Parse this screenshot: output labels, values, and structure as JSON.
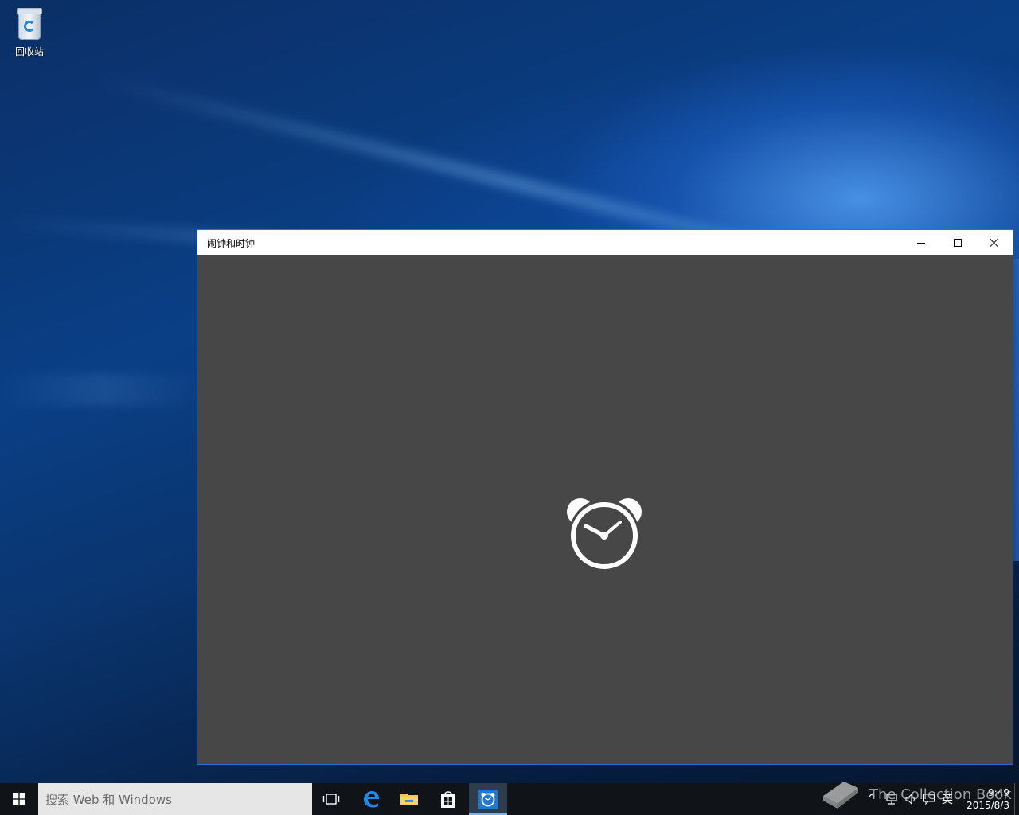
{
  "desktop": {
    "icons": [
      {
        "label": "回收站",
        "icon": "recycle-bin-icon"
      }
    ]
  },
  "window": {
    "title": "闹钟和时钟",
    "controls": {
      "minimize": "minimize-icon",
      "maximize": "maximize-icon",
      "close": "close-icon"
    },
    "background": "#474747",
    "splash_icon": "alarm-clock-icon"
  },
  "taskbar": {
    "search_placeholder": "搜索 Web 和 Windows",
    "pinned": [
      "task-view-icon",
      "edge-icon",
      "file-explorer-icon",
      "store-icon",
      "alarms-clock-icon"
    ],
    "active_app": "alarms-clock-icon",
    "tray": {
      "ime_label": "英",
      "time": "9:49",
      "date": "2015/8/3"
    }
  },
  "watermark": {
    "text": "The Collection Book"
  },
  "colors": {
    "accent": "#2f6fc4",
    "taskbar": "#101418",
    "search_bg": "#e6e6e6"
  }
}
